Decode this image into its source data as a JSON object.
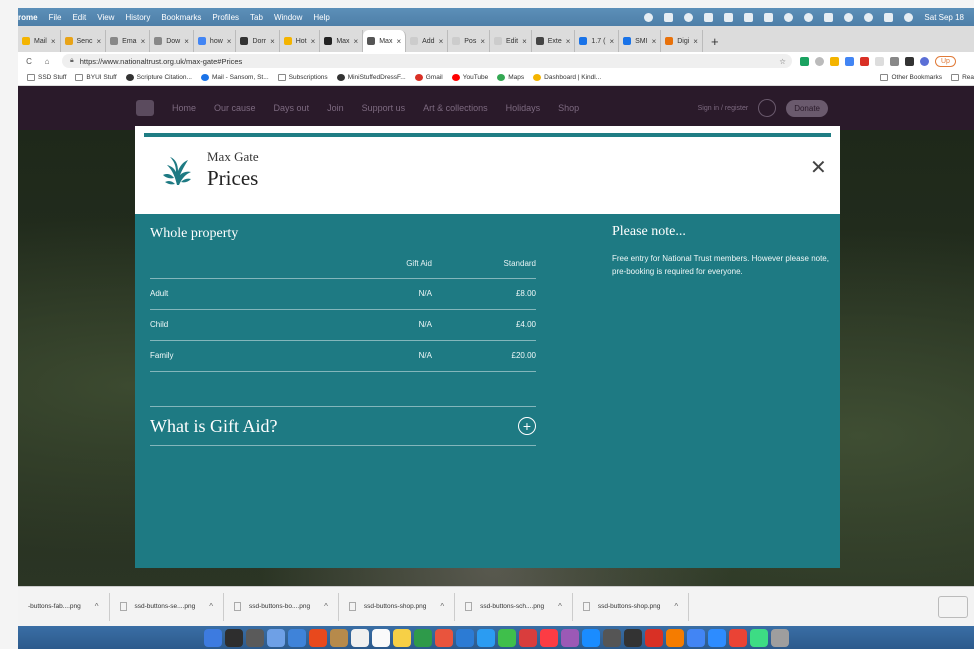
{
  "menubar": {
    "items": [
      "rome",
      "File",
      "Edit",
      "View",
      "History",
      "Bookmarks",
      "Profiles",
      "Tab",
      "Window",
      "Help"
    ],
    "clock": "Sat Sep 18"
  },
  "tabs": [
    {
      "label": "Mail",
      "color": "#f4b400"
    },
    {
      "label": "Senc",
      "color": "#e8a317"
    },
    {
      "label": "Ema",
      "color": "#888888"
    },
    {
      "label": "Dow",
      "color": "#888888"
    },
    {
      "label": "how",
      "color": "#4285f4"
    },
    {
      "label": "Dorr",
      "color": "#333333"
    },
    {
      "label": "Hot",
      "color": "#f4b400"
    },
    {
      "label": "Max",
      "color": "#222222"
    },
    {
      "label": "Max",
      "color": "#555555",
      "active": true
    },
    {
      "label": "Add",
      "color": "#cccccc"
    },
    {
      "label": "Pos",
      "color": "#cccccc"
    },
    {
      "label": "Edit",
      "color": "#cccccc"
    },
    {
      "label": "Exte",
      "color": "#444444"
    },
    {
      "label": "1.7 (",
      "color": "#1a73e8"
    },
    {
      "label": "SMI",
      "color": "#1a73e8"
    },
    {
      "label": "Digi",
      "color": "#e8710a"
    }
  ],
  "toolbar": {
    "url": "https://www.nationaltrust.org.uk/max-gate#Prices",
    "update_label": "Up"
  },
  "bookmarks": [
    "SSD Stuff",
    "BYUI Stuff",
    "Scripture Citation...",
    "Mail - Sansom, St...",
    "Subscriptions",
    "MiniStuffedDressF...",
    "Gmail",
    "YouTube",
    "Maps",
    "Dashboard | Kindl..."
  ],
  "bookmarks_right": [
    "Other Bookmarks",
    "Rea"
  ],
  "site_nav": {
    "links": [
      "Home",
      "Our cause",
      "Days out",
      "Join",
      "Support us",
      "Art & collections",
      "Holidays",
      "Shop"
    ],
    "signin": "Sign in / register",
    "donate": "Donate"
  },
  "modal": {
    "property_name": "Max Gate",
    "title": "Prices",
    "section_title": "Whole property",
    "columns": [
      "",
      "Gift Aid",
      "Standard"
    ],
    "rows": [
      {
        "type": "Adult",
        "gift_aid": "N/A",
        "standard": "£8.00"
      },
      {
        "type": "Child",
        "gift_aid": "N/A",
        "standard": "£4.00"
      },
      {
        "type": "Family",
        "gift_aid": "N/A",
        "standard": "£20.00"
      }
    ],
    "gift_aid_question": "What is Gift Aid?",
    "note_title": "Please note...",
    "note_body": "Free entry for National Trust members. However please note, pre-booking is required for everyone.",
    "accent_color": "#1e7a83"
  },
  "downloads": [
    "-buttons-fab....png",
    "ssd-buttons-se....png",
    "ssd-buttons-bo....png",
    "ssd-buttons-shop.png",
    "ssd-buttons-sch....png",
    "ssd-buttons-shop.png"
  ]
}
